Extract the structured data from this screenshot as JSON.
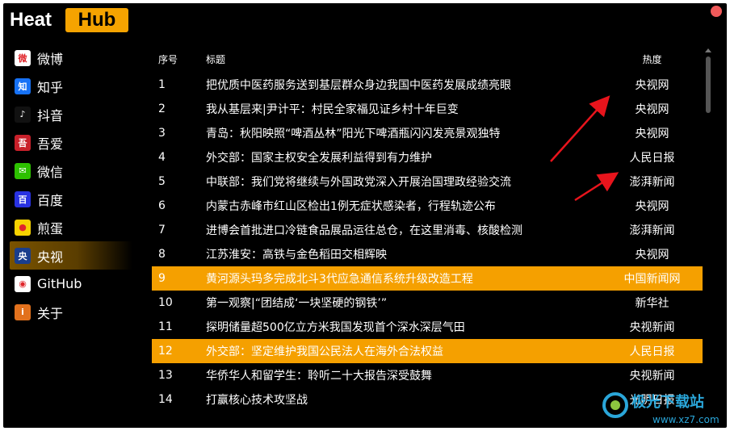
{
  "app": {
    "logo_left": "Heat",
    "logo_right": "Hub"
  },
  "sidebar": {
    "items": [
      {
        "label": "微博",
        "icon": "weibo-icon",
        "color": "#ffffff",
        "glyph": "微",
        "active": false
      },
      {
        "label": "知乎",
        "icon": "zhihu-icon",
        "color": "#1772f6",
        "glyph": "知",
        "active": false
      },
      {
        "label": "抖音",
        "icon": "douyin-icon",
        "color": "#111111",
        "glyph": "♪",
        "active": false
      },
      {
        "label": "吾爱",
        "icon": "52pojie-icon",
        "color": "#c8202a",
        "glyph": "吾",
        "active": false
      },
      {
        "label": "微信",
        "icon": "wechat-icon",
        "color": "#2dc100",
        "glyph": "✉",
        "active": false
      },
      {
        "label": "百度",
        "icon": "baidu-icon",
        "color": "#2932e1",
        "glyph": "百",
        "active": false
      },
      {
        "label": "煎蛋",
        "icon": "jandan-icon",
        "color": "#f6d200",
        "glyph": "●",
        "active": false
      },
      {
        "label": "央视",
        "icon": "cctv-icon",
        "color": "#1a3e8c",
        "glyph": "央",
        "active": true
      },
      {
        "label": "GitHub",
        "icon": "github-icon",
        "color": "#ffffff",
        "glyph": "◉",
        "active": false
      },
      {
        "label": "关于",
        "icon": "info-icon",
        "color": "#e2711d",
        "glyph": "i",
        "active": false
      }
    ]
  },
  "table": {
    "headers": {
      "no": "序号",
      "title": "标题",
      "heat": "热度"
    },
    "rows": [
      {
        "no": "1",
        "title": "把优质中医药服务送到基层群众身边我国中医药发展成绩亮眼",
        "heat": "央视网",
        "hl": false
      },
      {
        "no": "2",
        "title": "我从基层来|尹计平：村民全家福见证乡村十年巨变",
        "heat": "央视网",
        "hl": false
      },
      {
        "no": "3",
        "title": "青岛：秋阳映照“啤酒丛林”阳光下啤酒瓶闪闪发亮景观独特",
        "heat": "央视网",
        "hl": false
      },
      {
        "no": "4",
        "title": "外交部：国家主权安全发展利益得到有力维护",
        "heat": "人民日报",
        "hl": false
      },
      {
        "no": "5",
        "title": "中联部：我们党将继续与外国政党深入开展治国理政经验交流",
        "heat": "澎湃新闻",
        "hl": false
      },
      {
        "no": "6",
        "title": "内蒙古赤峰市红山区检出1例无症状感染者，行程轨迹公布",
        "heat": "央视网",
        "hl": false
      },
      {
        "no": "7",
        "title": "进博会首批进口冷链食品展品运往总仓，在这里消毒、核酸检测",
        "heat": "澎湃新闻",
        "hl": false
      },
      {
        "no": "8",
        "title": "江苏淮安：高铁与金色稻田交相辉映",
        "heat": "央视网",
        "hl": false
      },
      {
        "no": "9",
        "title": "黄河源头玛多完成北斗3代应急通信系统升级改造工程",
        "heat": "中国新闻网",
        "hl": true
      },
      {
        "no": "10",
        "title": "第一观察|“团结成‘一块坚硬的钢铁’”",
        "heat": "新华社",
        "hl": false
      },
      {
        "no": "11",
        "title": "探明储量超500亿立方米我国发现首个深水深层气田",
        "heat": "央视新闻",
        "hl": false
      },
      {
        "no": "12",
        "title": "外交部：坚定维护我国公民法人在海外合法权益",
        "heat": "人民日报",
        "hl": true
      },
      {
        "no": "13",
        "title": "华侨华人和留学生：聆听二十大报告深受鼓舞",
        "heat": "央视新闻",
        "hl": false
      },
      {
        "no": "14",
        "title": "打赢核心技术攻坚战",
        "heat": "光明日报",
        "hl": false
      }
    ]
  },
  "watermark": {
    "text": "极光下载站",
    "url": "www.xz7.com"
  },
  "colors": {
    "accent": "#f5a000",
    "close": "#f05a5a",
    "arrow": "#e8141c"
  }
}
